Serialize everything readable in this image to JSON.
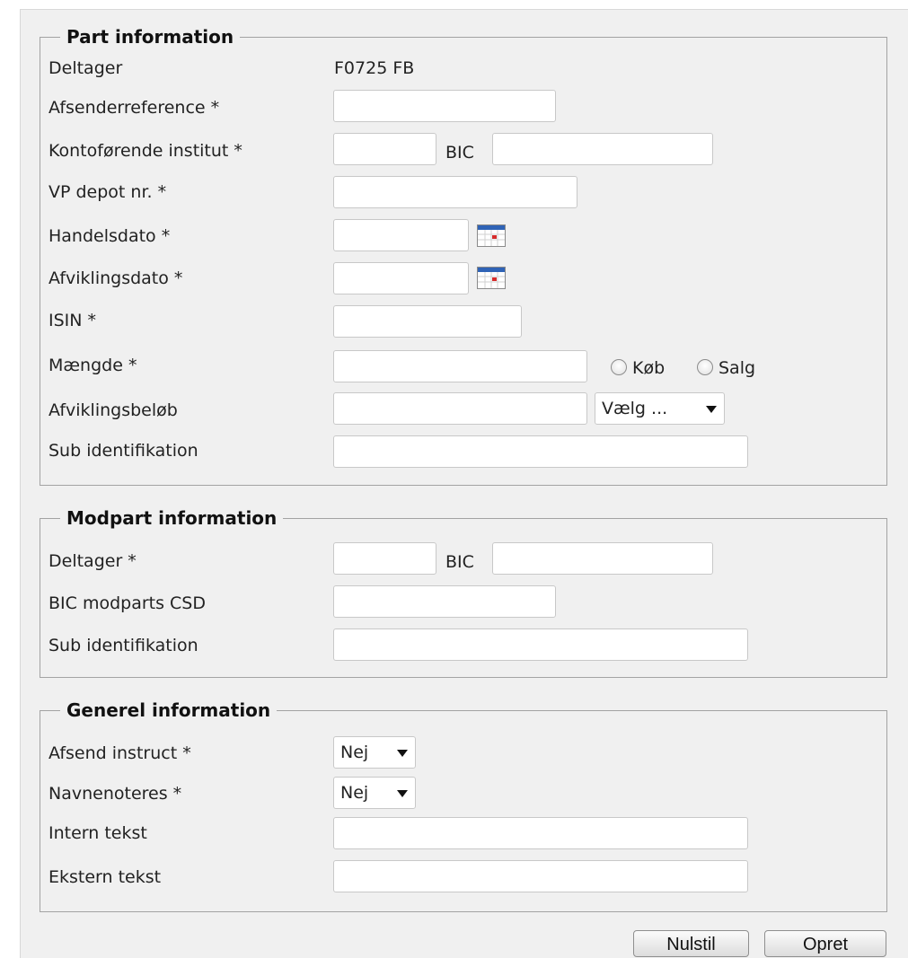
{
  "part": {
    "legend": "Part information",
    "deltager_label": "Deltager",
    "deltager_value": "F0725 FB",
    "afsenderreference_label": "Afsenderreference *",
    "kontoforende_label": "Kontoførende institut *",
    "bic_label": "BIC",
    "vp_depot_label": "VP depot nr. *",
    "handelsdato_label": "Handelsdato *",
    "afviklingsdato_label": "Afviklingsdato *",
    "isin_label": "ISIN *",
    "maengde_label": "Mængde *",
    "kob_label": "Køb",
    "salg_label": "Salg",
    "afviklingsbelob_label": "Afviklingsbeløb",
    "currency_select_value": "Vælg ...",
    "sub_identifikation_label": "Sub identifikation"
  },
  "modpart": {
    "legend": "Modpart information",
    "deltager_label": "Deltager *",
    "bic_label": "BIC",
    "bic_csd_label": "BIC modparts CSD",
    "sub_identifikation_label": "Sub identifikation"
  },
  "generel": {
    "legend": "Generel information",
    "afsend_instruct_label": "Afsend instruct *",
    "afsend_instruct_value": "Nej",
    "navnenoteres_label": "Navnenoteres *",
    "navnenoteres_value": "Nej",
    "intern_tekst_label": "Intern tekst",
    "ekstern_tekst_label": "Ekstern tekst"
  },
  "buttons": {
    "nulstil_label": "Nulstil",
    "opret_label": "Opret"
  },
  "icons": {
    "calendar": "calendar-icon",
    "dropdown": "chevron-down-icon"
  }
}
